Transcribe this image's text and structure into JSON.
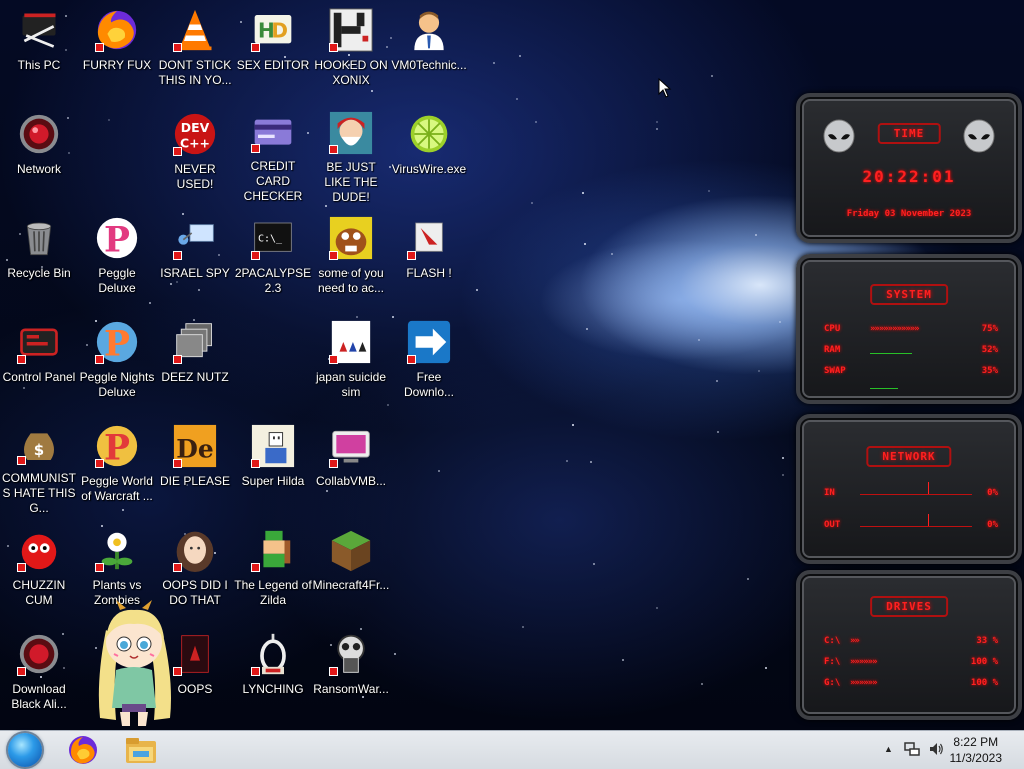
{
  "desktop": {
    "icons": [
      {
        "id": "this-pc",
        "label": "This PC"
      },
      {
        "id": "furry-fux",
        "label": "FURRY FUX"
      },
      {
        "id": "dont-stick",
        "label": "DONT STICK THIS IN YO..."
      },
      {
        "id": "sex-editor",
        "label": "SEX EDITOR"
      },
      {
        "id": "hooked-on-xonix",
        "label": "HOOKED ON XONIX"
      },
      {
        "id": "vm0technic",
        "label": "VM0Technic..."
      },
      {
        "id": "network",
        "label": "Network"
      },
      {
        "id": "never-used",
        "label": "NEVER USED!"
      },
      {
        "id": "credit-card-checker",
        "label": "CREDIT CARD CHECKER"
      },
      {
        "id": "be-just-like",
        "label": "BE JUST LIKE THE DUDE!"
      },
      {
        "id": "viruswire",
        "label": "VirusWire.exe"
      },
      {
        "id": "recycle-bin",
        "label": "Recycle Bin"
      },
      {
        "id": "peggle-deluxe",
        "label": "Peggle Deluxe"
      },
      {
        "id": "israel-spy",
        "label": "ISRAEL SPY"
      },
      {
        "id": "2pacalypse",
        "label": "2PACALYPSE 2.3"
      },
      {
        "id": "some-of-you",
        "label": "some of you need to ac..."
      },
      {
        "id": "flash",
        "label": "FLASH !"
      },
      {
        "id": "control-panel",
        "label": "Control Panel"
      },
      {
        "id": "peggle-nights",
        "label": "Peggle Nights Deluxe"
      },
      {
        "id": "deez-nutz",
        "label": "DEEZ NUTZ"
      },
      {
        "id": "japan-suicide-sim",
        "label": "japan suicide sim"
      },
      {
        "id": "free-download",
        "label": "Free Downlo..."
      },
      {
        "id": "communists",
        "label": "COMMUNISTS HATE THIS G..."
      },
      {
        "id": "peggle-world",
        "label": "Peggle World of Warcraft ..."
      },
      {
        "id": "die-please",
        "label": "DIE PLEASE"
      },
      {
        "id": "super-hilda",
        "label": "Super Hilda"
      },
      {
        "id": "collabvmb",
        "label": "CollabVMB..."
      },
      {
        "id": "chuzzin-cum",
        "label": "CHUZZIN CUM"
      },
      {
        "id": "plants-vs-zombies",
        "label": "Plants vs Zombies"
      },
      {
        "id": "oops-did-i",
        "label": "OOPS DID I DO THAT"
      },
      {
        "id": "legend-of-zilda",
        "label": "The Legend of Zilda"
      },
      {
        "id": "minecraft4fr",
        "label": "Minecraft4Fr..."
      },
      {
        "id": "download-black-ali",
        "label": "Download Black Ali..."
      },
      {
        "id": "oops",
        "label": "OOPS"
      },
      {
        "id": "lynching",
        "label": "LYNCHING"
      },
      {
        "id": "ransomwar",
        "label": "RansomWar..."
      }
    ]
  },
  "widgets": {
    "time": {
      "title": "TIME",
      "clock": "20:22:01",
      "date": "Friday 03 November 2023"
    },
    "system": {
      "title": "SYSTEM",
      "rows": [
        {
          "name": "CPU",
          "value": "75%",
          "level": 0.75,
          "has_bar": true
        },
        {
          "name": "RAM",
          "value": "52%",
          "level": 0.52,
          "has_bar": false
        },
        {
          "name": "SWAP",
          "value": "35%",
          "level": 0.35,
          "has_bar": false
        }
      ]
    },
    "network": {
      "title": "NETWORK",
      "rows": [
        {
          "name": "IN",
          "value": "0%"
        },
        {
          "name": "OUT",
          "value": "0%"
        }
      ]
    },
    "drives": {
      "title": "DRIVES",
      "rows": [
        {
          "name": "C:\\",
          "value": "33 %",
          "level": 0.33
        },
        {
          "name": "F:\\",
          "value": "100 %",
          "level": 1.0
        },
        {
          "name": "G:\\",
          "value": "100 %",
          "level": 1.0
        }
      ]
    }
  },
  "taskbar": {
    "clock_time": "8:22 PM",
    "clock_date": "11/3/2023",
    "apps": [
      "firefox-icon",
      "file-explorer-icon"
    ]
  },
  "colors": {
    "accent_red": "#ff2020",
    "taskbar_bg": "#dde1e6"
  }
}
